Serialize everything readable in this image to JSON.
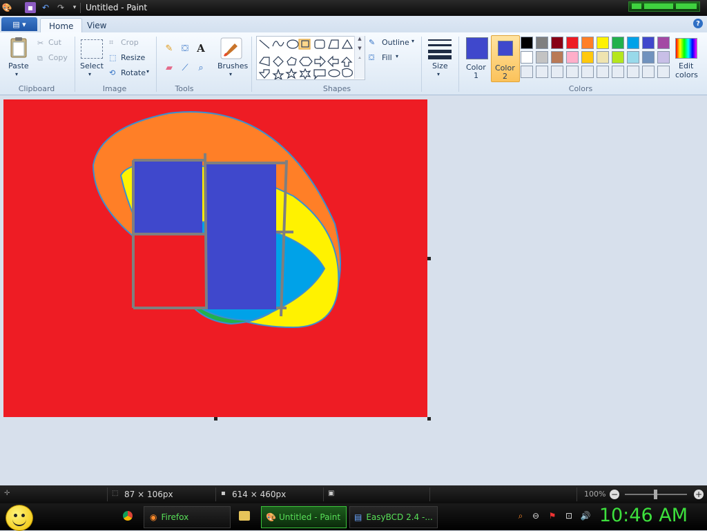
{
  "titlebar": {
    "title": "Untitled - Paint"
  },
  "tabs": [
    {
      "label": "Home"
    },
    {
      "label": "View"
    }
  ],
  "clipboard": {
    "paste": "Paste",
    "cut": "Cut",
    "copy": "Copy",
    "group": "Clipboard"
  },
  "image": {
    "select": "Select",
    "crop": "Crop",
    "resize": "Resize",
    "rotate": "Rotate",
    "group": "Image"
  },
  "tools": {
    "group": "Tools",
    "text_glyph": "A"
  },
  "brushes": {
    "label": "Brushes"
  },
  "shapes": {
    "outline": "Outline",
    "fill": "Fill",
    "group": "Shapes"
  },
  "size": {
    "label": "Size"
  },
  "colors": {
    "color1_label_line1": "Color",
    "color1_label_line2": "1",
    "color2_label_line1": "Color",
    "color2_label_line2": "2",
    "edit_line1": "Edit",
    "edit_line2": "colors",
    "group": "Colors",
    "color1": "#3f48cc",
    "color2": "#3f48cc",
    "palette_row1": [
      "#000000",
      "#7f7f7f",
      "#880015",
      "#ed1c24",
      "#ff7f27",
      "#fff200",
      "#22b14c",
      "#00a2e8",
      "#3f48cc",
      "#a349a4"
    ],
    "palette_row2": [
      "#ffffff",
      "#c3c3c3",
      "#b97a57",
      "#ffaec9",
      "#ffc90e",
      "#efe4b0",
      "#b5e61d",
      "#99d9ea",
      "#7092be",
      "#c8bfe7"
    ],
    "palette_row3": [
      "#e6ecf4",
      "#e6ecf4",
      "#e6ecf4",
      "#e6ecf4",
      "#e6ecf4",
      "#e6ecf4",
      "#e6ecf4",
      "#e6ecf4",
      "#e6ecf4",
      "#e6ecf4"
    ]
  },
  "canvas": {
    "background": "#ee1c24"
  },
  "status": {
    "selection_size": "87 × 106px",
    "canvas_size": "614 × 460px",
    "zoom": "100%"
  },
  "taskbar": {
    "items": [
      {
        "label": "Firefox"
      },
      {
        "label": "Untitled - Paint"
      },
      {
        "label": "EasyBCD 2.4 -..."
      }
    ],
    "clock": "10:46 AM"
  }
}
